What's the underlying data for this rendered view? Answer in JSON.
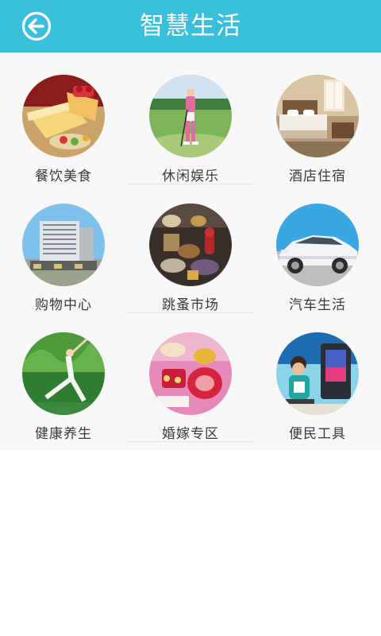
{
  "header": {
    "title": "智慧生活",
    "accent_color": "#39bfd9",
    "back_icon": "back-arrow-circle-icon"
  },
  "tiles": [
    {
      "label": "餐饮美食"
    },
    {
      "label": "休闲娱乐"
    },
    {
      "label": "酒店住宿"
    },
    {
      "label": "购物中心"
    },
    {
      "label": "跳蚤市场"
    },
    {
      "label": "汽车生活"
    },
    {
      "label": "健康养生"
    },
    {
      "label": "婚嫁专区"
    },
    {
      "label": "便民工具"
    }
  ]
}
